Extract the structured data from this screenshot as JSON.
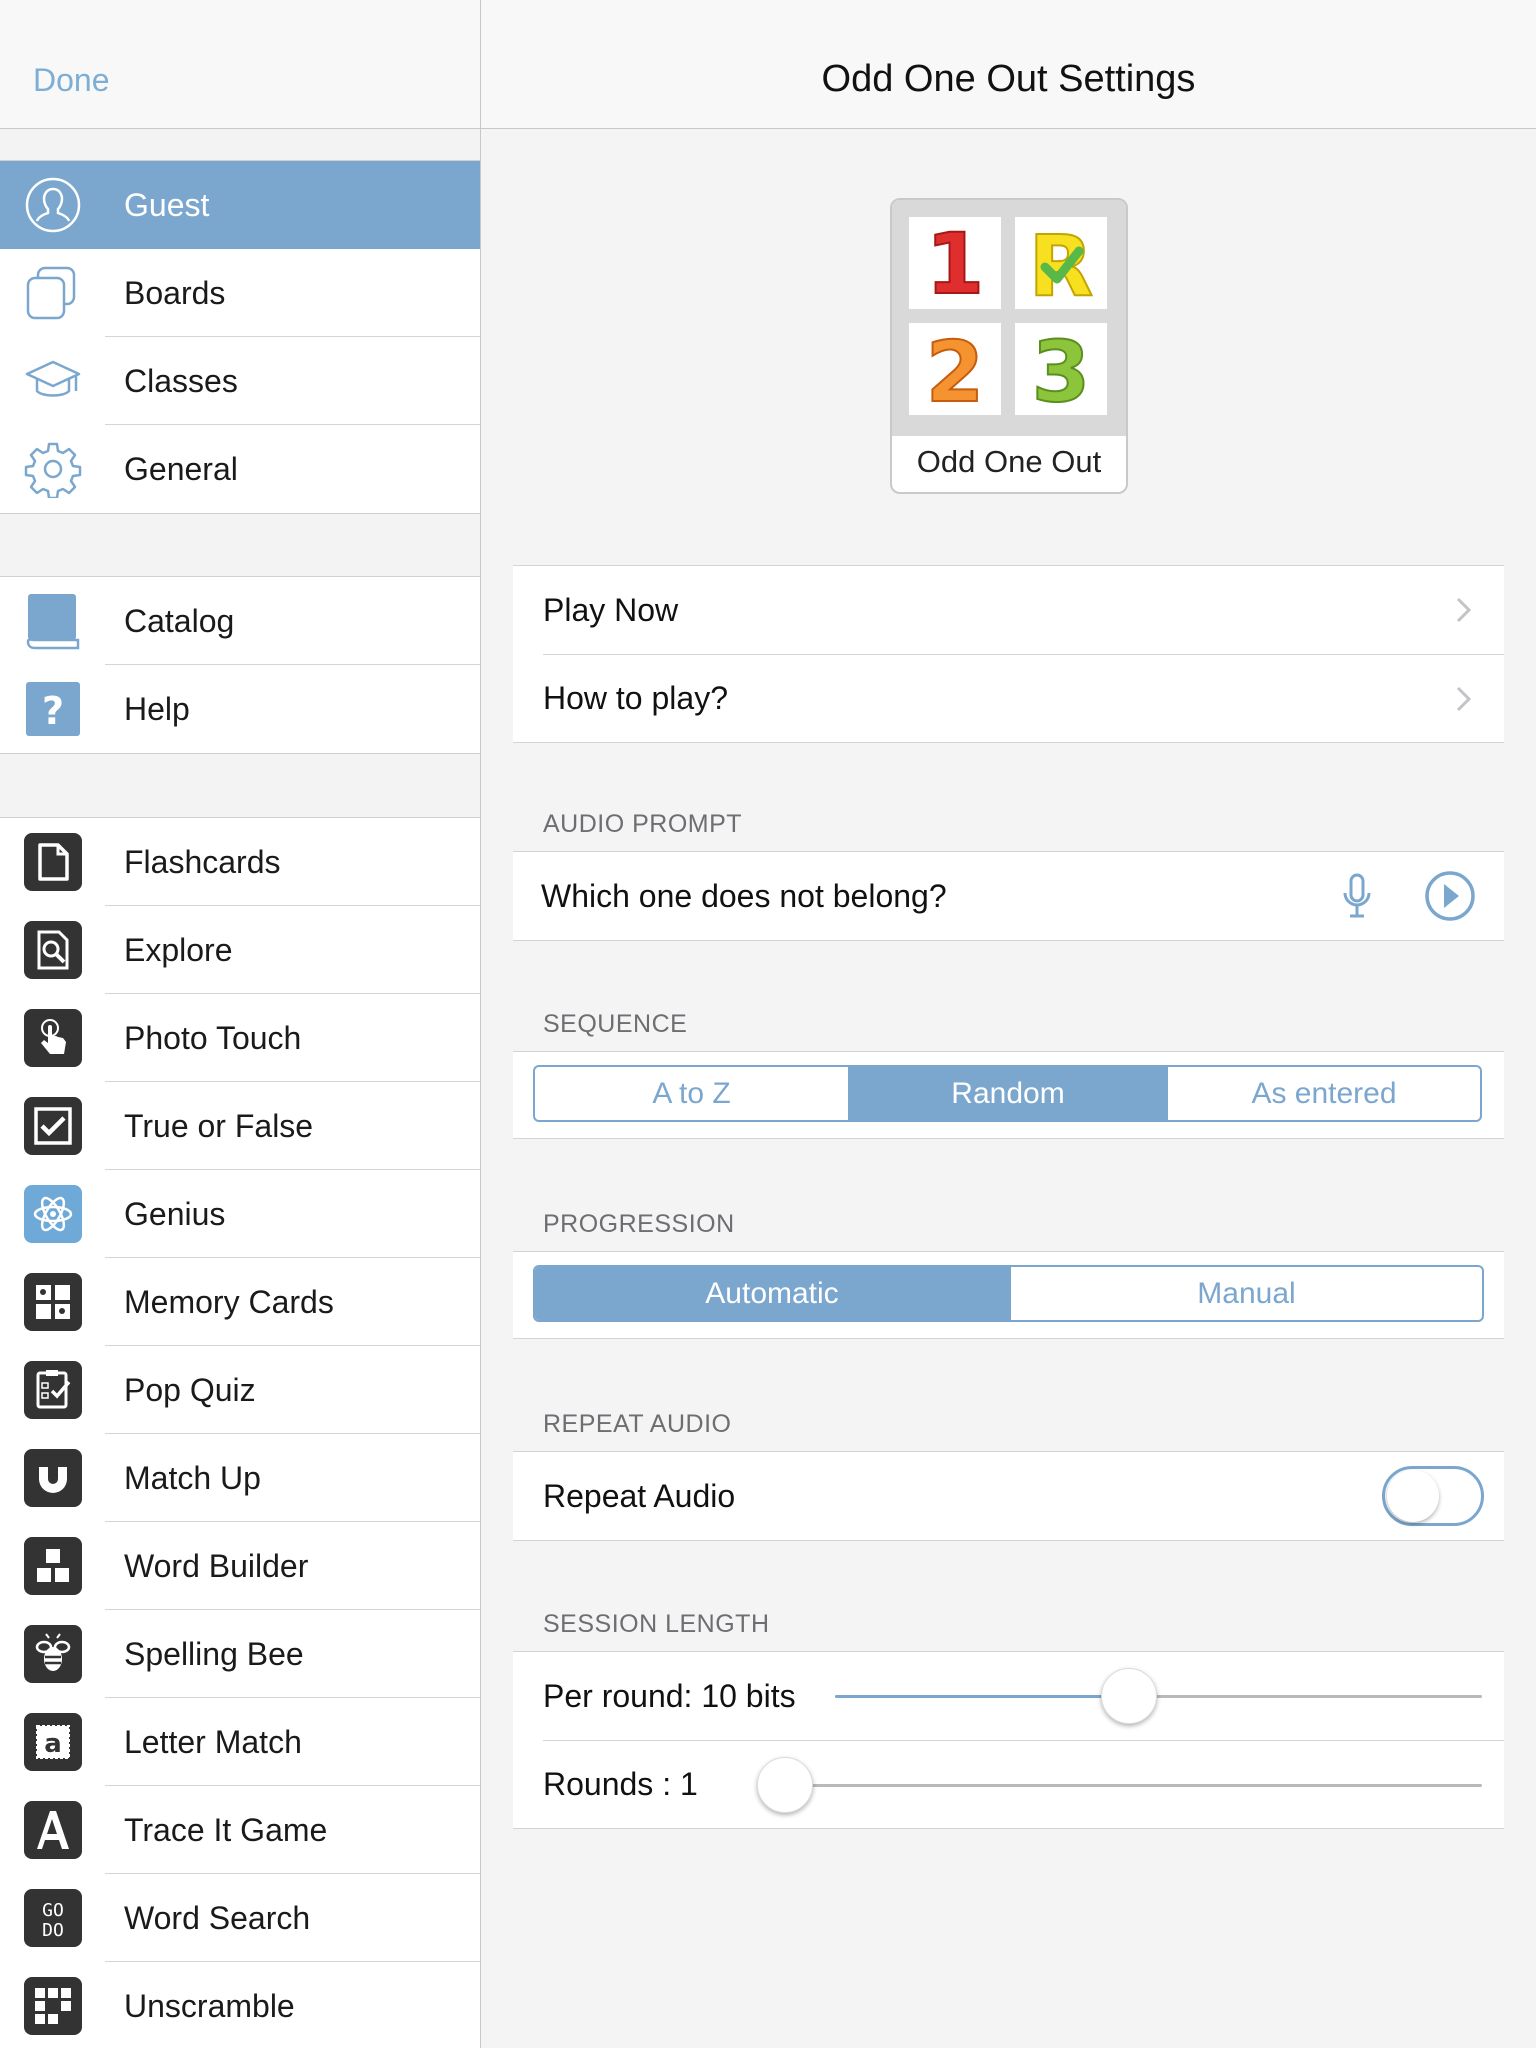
{
  "sidebar": {
    "done_label": "Done",
    "account": [
      {
        "label": "Guest",
        "icon": "user-icon",
        "selected": true
      },
      {
        "label": "Boards",
        "icon": "boards-icon"
      },
      {
        "label": "Classes",
        "icon": "graduation-cap-icon"
      },
      {
        "label": "General",
        "icon": "gear-icon"
      }
    ],
    "info": [
      {
        "label": "Catalog",
        "icon": "book-icon"
      },
      {
        "label": "Help",
        "icon": "question-icon"
      }
    ],
    "games": [
      {
        "label": "Flashcards",
        "icon": "flashcards-icon"
      },
      {
        "label": "Explore",
        "icon": "explore-icon"
      },
      {
        "label": "Photo Touch",
        "icon": "touch-icon"
      },
      {
        "label": "True or False",
        "icon": "checkbox-icon"
      },
      {
        "label": "Genius",
        "icon": "atom-icon"
      },
      {
        "label": "Memory Cards",
        "icon": "memory-cards-icon"
      },
      {
        "label": "Pop Quiz",
        "icon": "quiz-icon"
      },
      {
        "label": "Match Up",
        "icon": "magnet-icon"
      },
      {
        "label": "Word Builder",
        "icon": "blocks-icon"
      },
      {
        "label": "Spelling Bee",
        "icon": "bee-icon"
      },
      {
        "label": "Letter Match",
        "icon": "letter-a-stamp-icon"
      },
      {
        "label": "Trace It Game",
        "icon": "trace-a-icon"
      },
      {
        "label": "Word Search",
        "icon": "word-search-icon"
      },
      {
        "label": "Unscramble",
        "icon": "unscramble-icon"
      }
    ]
  },
  "main": {
    "title": "Odd One Out Settings",
    "tile": {
      "label": "Odd One Out",
      "glyphs": [
        "1",
        "R",
        "2",
        "3"
      ]
    },
    "nav_rows": [
      {
        "label": "Play Now"
      },
      {
        "label": "How to play?"
      }
    ],
    "audio_prompt": {
      "section": "AUDIO PROMPT",
      "text": "Which one does not belong?"
    },
    "sequence": {
      "section": "SEQUENCE",
      "options": [
        "A to Z",
        "Random",
        "As entered"
      ],
      "selected": "Random"
    },
    "progression": {
      "section": "PROGRESSION",
      "options": [
        "Automatic",
        "Manual"
      ],
      "selected": "Automatic"
    },
    "repeat_audio": {
      "section": "REPEAT AUDIO",
      "label": "Repeat Audio",
      "on": false
    },
    "session_length": {
      "section": "SESSION LENGTH",
      "per_round_label": "Per round: 10 bits",
      "per_round_fraction": 0.45,
      "rounds_label": "Rounds : 1",
      "rounds_fraction": 0.0
    }
  },
  "colors": {
    "accent": "#7ba7cf",
    "done_text": "#7eaed3"
  }
}
